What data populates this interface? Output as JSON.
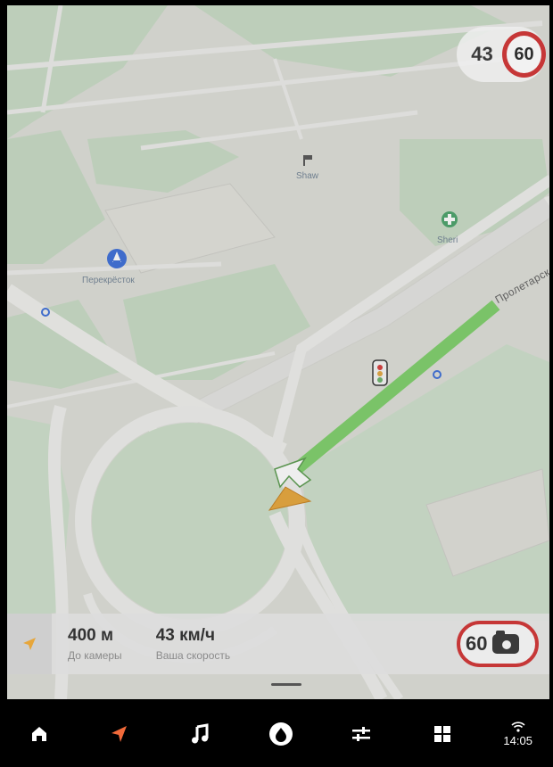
{
  "map": {
    "street_label": "Пролетарск",
    "poi_store_label": "Перекрёсток",
    "poi_pharmacy_label": "Sheri",
    "poi_top_label": "Shaw"
  },
  "speed": {
    "current": "43",
    "limit": "60"
  },
  "info_panel": {
    "distance_value": "400 м",
    "distance_caption": "До камеры",
    "speed_value": "43 км/ч",
    "speed_caption": "Ваша скорость",
    "camera_limit": "60"
  },
  "nav": {
    "items": [
      {
        "icon": "home-icon"
      },
      {
        "icon": "navigation-icon",
        "active": true,
        "color": "#f26a3a"
      },
      {
        "icon": "music-icon"
      },
      {
        "icon": "alice-assistant-icon"
      },
      {
        "icon": "settings-sliders-icon"
      },
      {
        "icon": "apps-grid-icon"
      }
    ]
  },
  "status": {
    "time": "14:05",
    "icon": "wifi-icon"
  },
  "colors": {
    "route": "#7ed06a",
    "speed_limit_ring": "#c63737",
    "cursor": "#e7a63a",
    "accent": "#f26a3a"
  }
}
